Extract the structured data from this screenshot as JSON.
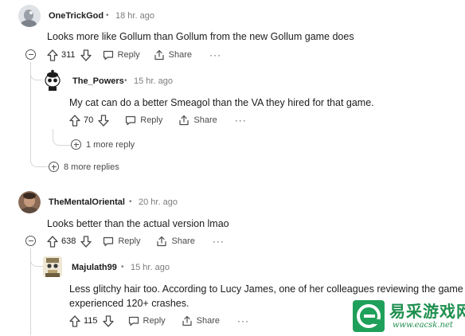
{
  "comments": [
    {
      "username": "OneTrickGod",
      "separator": "•",
      "time": "18 hr. ago",
      "body": "Looks more like Gollum than Gollum from the new Gollum game does",
      "votes": "311",
      "reply": "Reply",
      "share": "Share",
      "more": "···",
      "more_replies": "8 more replies",
      "replies": [
        {
          "username": "The_Powers",
          "separator": "•",
          "time": "15 hr. ago",
          "body": "My cat can do a better Smeagol than the VA they hired for that game.",
          "votes": "70",
          "reply": "Reply",
          "share": "Share",
          "more": "···",
          "more_replies": "1 more reply"
        }
      ]
    },
    {
      "username": "TheMentalOriental",
      "separator": "•",
      "time": "20 hr. ago",
      "body": "Looks better than the actual version lmao",
      "votes": "638",
      "reply": "Reply",
      "share": "Share",
      "more": "···",
      "replies": [
        {
          "username": "Majulath99",
          "separator": "•",
          "time": "15 hr. ago",
          "body_lines": [
            "Less glitchy hair too. According to Lucy James, one of her colleagues reviewing the game",
            "experienced 120+ crashes."
          ],
          "votes": "115",
          "reply": "Reply",
          "share": "Share",
          "more": "···"
        }
      ]
    }
  ],
  "watermark": {
    "title": "易采游戏网",
    "url": "www.eacsk.net"
  },
  "colors": {
    "text": "#1c1c1c",
    "muted": "#7c7c7c",
    "thread": "#d6d6d6",
    "watermark": "#1f8f4f"
  },
  "icons": [
    "upvote-icon",
    "downvote-icon",
    "reply-icon",
    "share-icon",
    "collapse-icon",
    "expand-icon"
  ]
}
